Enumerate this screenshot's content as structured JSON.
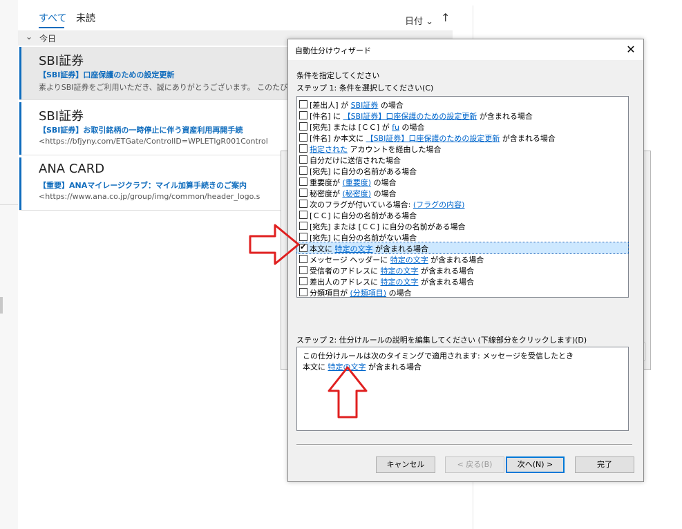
{
  "mail_list": {
    "tabs": [
      {
        "label": "すべて",
        "active": true
      },
      {
        "label": "未読",
        "active": false
      }
    ],
    "sort_label": "日付",
    "sort_chevron": "⌄",
    "sort_direction_icon": "↑",
    "group_label": "今日",
    "group_chevron": "⌄",
    "items": [
      {
        "sender": "SBI証券",
        "subject": "【SBI証券】口座保護のための設定更新",
        "preview": "素よりSBI証券をご利用いただき、誠にありがとうございます。 このたび、お客様",
        "selected": true
      },
      {
        "sender": "SBI証券",
        "subject": "【SBI証券】お取引銘柄の一時停止に伴う資産利用再開手続",
        "preview": "<https://bfjyny.com/ETGate/ControlID=WPLETlgR001Control",
        "selected": false
      },
      {
        "sender": "ANA CARD",
        "subject": "【重要】ANAマイレージクラブ：マイル加算手続きのご案内",
        "preview": "<https://www.ana.co.jp/group/img/common/header_logo.s",
        "selected": false
      }
    ]
  },
  "dialog": {
    "title": "自動仕分けウィザード",
    "close_icon": "✕",
    "instruction": "条件を指定してください",
    "step1_label": "ステップ 1: 条件を選択してください(C)",
    "conditions": [
      {
        "parts": [
          [
            "t",
            "[差出人] が "
          ],
          [
            "l",
            "SBI証券"
          ],
          [
            "t",
            " の場合"
          ]
        ],
        "checked": false
      },
      {
        "parts": [
          [
            "t",
            "[件名] に "
          ],
          [
            "l",
            "【SBI証券】口座保護のための設定更新"
          ],
          [
            "t",
            " が含まれる場合"
          ]
        ],
        "checked": false
      },
      {
        "parts": [
          [
            "t",
            "[宛先] または [ＣＣ] が "
          ],
          [
            "l",
            "fu"
          ],
          [
            "t",
            " の場合"
          ]
        ],
        "checked": false
      },
      {
        "parts": [
          [
            "t",
            "[件名] か本文に "
          ],
          [
            "l",
            "【SBI証券】口座保護のための設定更新"
          ],
          [
            "t",
            " が含まれる場合"
          ]
        ],
        "checked": false
      },
      {
        "parts": [
          [
            "l",
            "指定された"
          ],
          [
            "t",
            " アカウントを経由した場合"
          ]
        ],
        "checked": false
      },
      {
        "parts": [
          [
            "t",
            "自分だけに送信された場合"
          ]
        ],
        "checked": false
      },
      {
        "parts": [
          [
            "t",
            "[宛先] に自分の名前がある場合"
          ]
        ],
        "checked": false
      },
      {
        "parts": [
          [
            "t",
            "重要度が "
          ],
          [
            "l",
            "(重要度)"
          ],
          [
            "t",
            " の場合"
          ]
        ],
        "checked": false
      },
      {
        "parts": [
          [
            "t",
            "秘密度が "
          ],
          [
            "l",
            "(秘密度)"
          ],
          [
            "t",
            " の場合"
          ]
        ],
        "checked": false
      },
      {
        "parts": [
          [
            "t",
            "次のフラグが付いている場合: "
          ],
          [
            "l",
            "(フラグの内容)"
          ]
        ],
        "checked": false
      },
      {
        "parts": [
          [
            "t",
            "[ＣＣ] に自分の名前がある場合"
          ]
        ],
        "checked": false
      },
      {
        "parts": [
          [
            "t",
            "[宛先] または [ＣＣ] に自分の名前がある場合"
          ]
        ],
        "checked": false
      },
      {
        "parts": [
          [
            "t",
            "[宛先] に自分の名前がない場合"
          ]
        ],
        "checked": false
      },
      {
        "parts": [
          [
            "t",
            "本文に "
          ],
          [
            "l",
            "特定の文字"
          ],
          [
            "t",
            " が含まれる場合"
          ]
        ],
        "checked": true,
        "highlighted": true
      },
      {
        "parts": [
          [
            "t",
            "メッセージ ヘッダーに "
          ],
          [
            "l",
            "特定の文字"
          ],
          [
            "t",
            " が含まれる場合"
          ]
        ],
        "checked": false
      },
      {
        "parts": [
          [
            "t",
            "受信者のアドレスに "
          ],
          [
            "l",
            "特定の文字"
          ],
          [
            "t",
            " が含まれる場合"
          ]
        ],
        "checked": false
      },
      {
        "parts": [
          [
            "t",
            "差出人のアドレスに "
          ],
          [
            "l",
            "特定の文字"
          ],
          [
            "t",
            " が含まれる場合"
          ]
        ],
        "checked": false
      },
      {
        "parts": [
          [
            "t",
            "分類項目が "
          ],
          [
            "l",
            "(分類項目)"
          ],
          [
            "t",
            " の場合"
          ]
        ],
        "checked": false
      }
    ],
    "step2_label": "ステップ 2: 仕分けルールの説明を編集してください (下線部分をクリックします)(D)",
    "description": {
      "line1": "この仕分けルールは次のタイミングで適用されます: メッセージを受信したとき",
      "line2_prefix": "本文に ",
      "line2_link": "特定の文字",
      "line2_suffix": " が含まれる場合"
    },
    "buttons": {
      "cancel": "キャンセル",
      "back": "< 戻る(B)",
      "next": "次へ(N) >",
      "finish": "完了"
    }
  },
  "colors": {
    "accent": "#0f6cbd",
    "link": "#0066cc",
    "annotation_arrow": "#e02020"
  }
}
